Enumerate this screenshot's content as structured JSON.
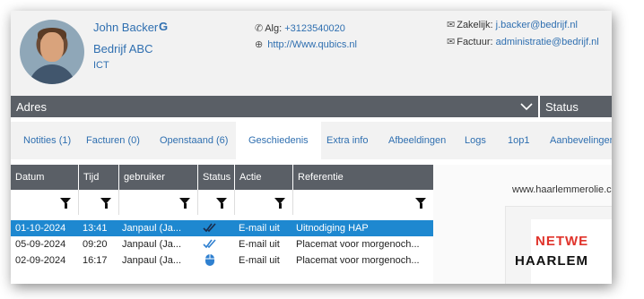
{
  "profile": {
    "name": "John Backer",
    "name_badge": "G",
    "company": "Bedrijf ABC",
    "department": "ICT"
  },
  "contacts": {
    "phone_label": "Alg:",
    "phone_value": "+3123540020",
    "website": "http://Www.qubics.nl",
    "business_label": "Zakelijk:",
    "business_email": "j.backer@bedrijf.nl",
    "invoice_label": "Factuur:",
    "invoice_email": "administratie@bedrijf.nl"
  },
  "sections": {
    "address": "Adres",
    "status": "Status"
  },
  "tabs": [
    {
      "label": "Notities (1)"
    },
    {
      "label": "Facturen (0)"
    },
    {
      "label": "Openstaand (6)"
    },
    {
      "label": "Geschiedenis",
      "active": true
    },
    {
      "label": "Extra info"
    },
    {
      "label": "Afbeeldingen"
    },
    {
      "label": "Logs"
    },
    {
      "label": "1op1"
    },
    {
      "label": "Aanbevelingen"
    }
  ],
  "grid": {
    "columns": [
      "Datum",
      "Tijd",
      "gebruiker",
      "Status",
      "Actie",
      "Referentie"
    ],
    "rows": [
      {
        "date": "01-10-2024",
        "time": "13:41",
        "user": "Janpaul (Ja...",
        "status_icon": "double-check-icon",
        "action": "E-mail uit",
        "ref": "Uitnodiging HAP",
        "selected": true
      },
      {
        "date": "05-09-2024",
        "time": "09:20",
        "user": "Janpaul (Ja...",
        "status_icon": "double-check-icon",
        "action": "E-mail uit",
        "ref": "Placemat voor morgenoch..."
      },
      {
        "date": "02-09-2024",
        "time": "16:17",
        "user": "Janpaul (Ja...",
        "status_icon": "mouse-icon",
        "action": "E-mail uit",
        "ref": "Placemat voor morgenoch..."
      }
    ]
  },
  "preview": {
    "url": "www.haarlemmerolie.c",
    "line1": "NETWE",
    "line2": "HAARLEM"
  },
  "colors": {
    "accent": "#2f6fb0",
    "bar": "#5a5f66",
    "selected_row": "#1e88d0",
    "brand_red": "#e0332b"
  }
}
